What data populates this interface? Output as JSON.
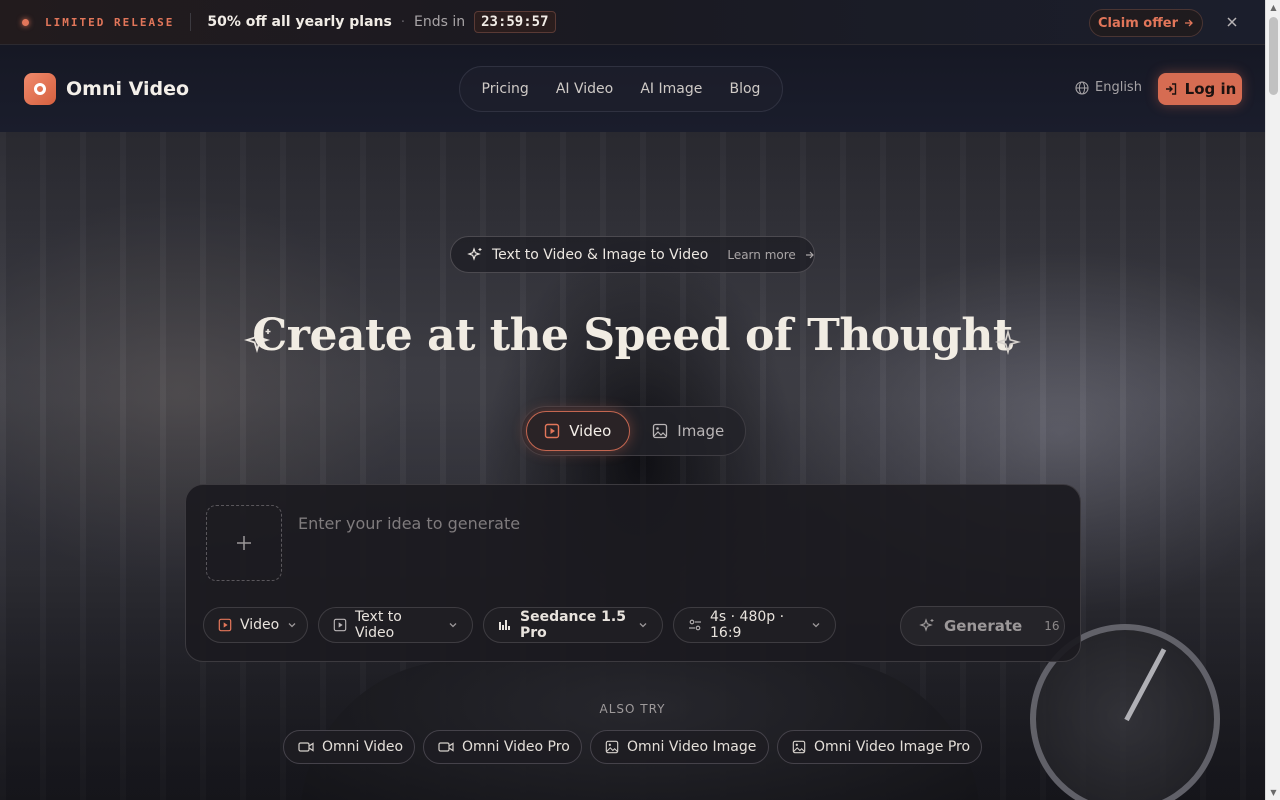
{
  "promo": {
    "tag": "LIMITED RELEASE",
    "offer": "50% off all yearly plans",
    "separator": "·",
    "ends_label": "Ends in",
    "timer": "23:59:57",
    "claim_label": "Claim offer",
    "accent_color": "#e2765a"
  },
  "nav": {
    "brand": "Omni Video",
    "links": [
      "Pricing",
      "AI Video",
      "AI Image",
      "Blog"
    ],
    "language": "English",
    "login_label": "Log in",
    "login_color": "#d66c52"
  },
  "hero": {
    "feature_label": "Text to Video & Image to Video",
    "learn_more": "Learn more",
    "headline": "Create at the Speed of Thought",
    "modes": [
      "Video",
      "Image"
    ],
    "active_mode": "Video"
  },
  "composer": {
    "placeholder": "Enter your idea to generate",
    "value": "",
    "chips": {
      "type": "Video",
      "task": "Text to Video",
      "model": "Seedance 1.5 Pro",
      "settings": "4s · 480p · 16:9"
    },
    "generate_label": "Generate",
    "credits": "16"
  },
  "also_try": {
    "label": "ALSO TRY",
    "items": [
      "Omni Video",
      "Omni Video Pro",
      "Omni Video Image",
      "Omni Video Image Pro"
    ]
  }
}
